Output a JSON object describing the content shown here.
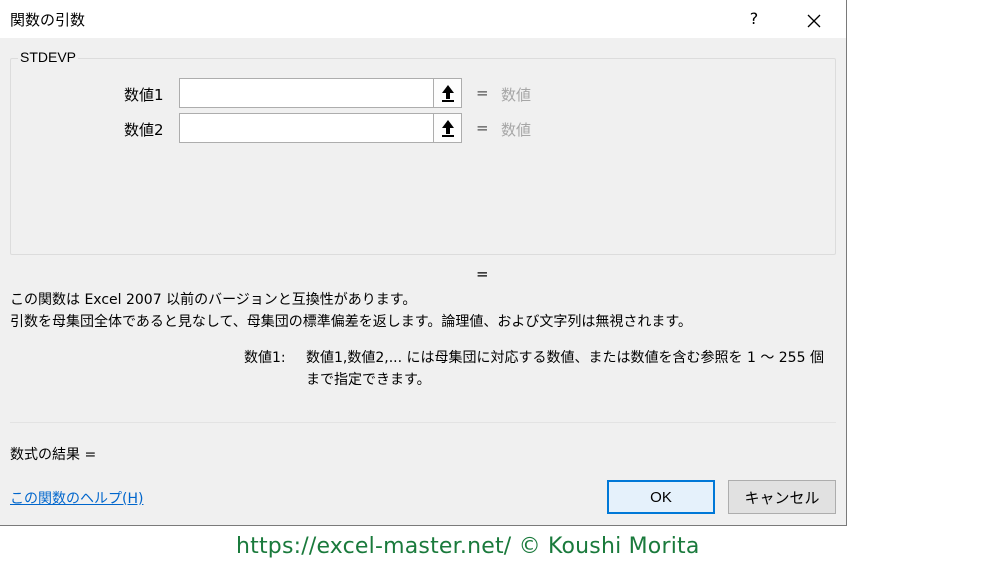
{
  "window": {
    "title": "関数の引数",
    "help_label": "?",
    "close_label": "✕"
  },
  "function": {
    "name": "STDEVP",
    "args": [
      {
        "label": "数値1",
        "value": "",
        "equals": "=",
        "hint": "数値"
      },
      {
        "label": "数値2",
        "value": "",
        "equals": "=",
        "hint": "数値"
      }
    ],
    "result_equals": "="
  },
  "description": {
    "line1": "この関数は Excel 2007 以前のバージョンと互換性があります。",
    "line2": "引数を母集団全体であると見なして、母集団の標準偏差を返します。論理値、および文字列は無視されます。",
    "param_name": "数値1:",
    "param_text": "数値1,数値2,... には母集団に対応する数値、または数値を含む参照を 1 ～ 255 個まで指定できます。"
  },
  "footer": {
    "formula_result": "数式の結果 =",
    "help_link": "この関数のヘルプ(H)",
    "ok_label": "OK",
    "cancel_label": "キャンセル"
  },
  "icons": {
    "ref_button": "collapse-dialog-arrow-icon"
  },
  "watermark": "https://excel-master.net/  © Koushi Morita"
}
